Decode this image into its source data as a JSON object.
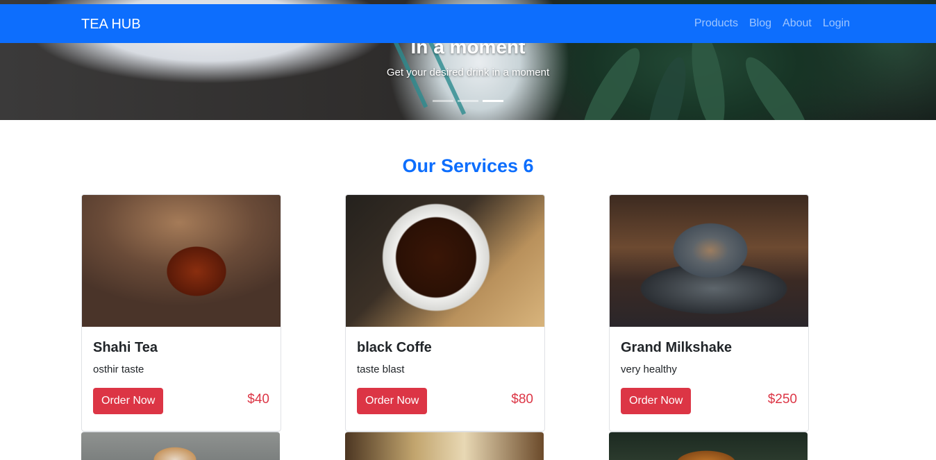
{
  "navbar": {
    "brand": "TEA HUB",
    "links": [
      "Products",
      "Blog",
      "About",
      "Login"
    ]
  },
  "hero": {
    "title": "In a moment",
    "subtitle": "Get your desired drink in a moment",
    "slide_count": 3,
    "active_slide": 3
  },
  "section": {
    "title": "Our Services 6"
  },
  "products": [
    {
      "name": "Shahi Tea",
      "description": "osthir taste",
      "button": "Order Now",
      "price": "$40"
    },
    {
      "name": "black Coffe",
      "description": "taste blast",
      "button": "Order Now",
      "price": "$80"
    },
    {
      "name": "Grand Milkshake",
      "description": "very healthy",
      "button": "Order Now",
      "price": "$250"
    }
  ],
  "colors": {
    "primary": "#0d6efd",
    "danger": "#dc3545"
  }
}
